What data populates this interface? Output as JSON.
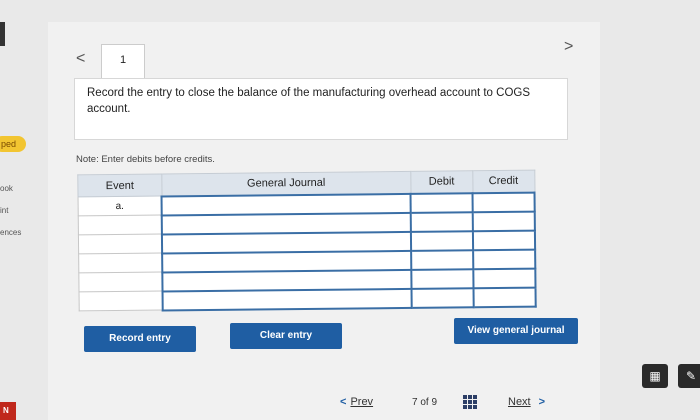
{
  "sidebar": {
    "badge": "ped",
    "items": [
      "ook",
      "int",
      "ences"
    ],
    "red_tag": "N"
  },
  "tabs": {
    "prev_glyph": "<",
    "current": "1",
    "next_glyph": ">"
  },
  "question": {
    "text": "Record the entry to close the balance of the manufacturing overhead account to COGS account.",
    "note": "Note: Enter debits before credits."
  },
  "journal": {
    "headers": [
      "Event",
      "General Journal",
      "Debit",
      "Credit"
    ],
    "rows": [
      {
        "event": "a.",
        "account": "",
        "debit": "",
        "credit": ""
      },
      {
        "event": "",
        "account": "",
        "debit": "",
        "credit": ""
      },
      {
        "event": "",
        "account": "",
        "debit": "",
        "credit": ""
      },
      {
        "event": "",
        "account": "",
        "debit": "",
        "credit": ""
      },
      {
        "event": "",
        "account": "",
        "debit": "",
        "credit": ""
      },
      {
        "event": "",
        "account": "",
        "debit": "",
        "credit": ""
      }
    ]
  },
  "buttons": {
    "record": "Record entry",
    "clear": "Clear entry",
    "view": "View general journal"
  },
  "navigation": {
    "prev": "Prev",
    "page_current": "7",
    "page_of": "of",
    "page_total": "9",
    "next": "Next"
  },
  "colors": {
    "primary_button": "#1f5ea3",
    "table_header": "#dde4ec",
    "badge": "#f2c531"
  }
}
